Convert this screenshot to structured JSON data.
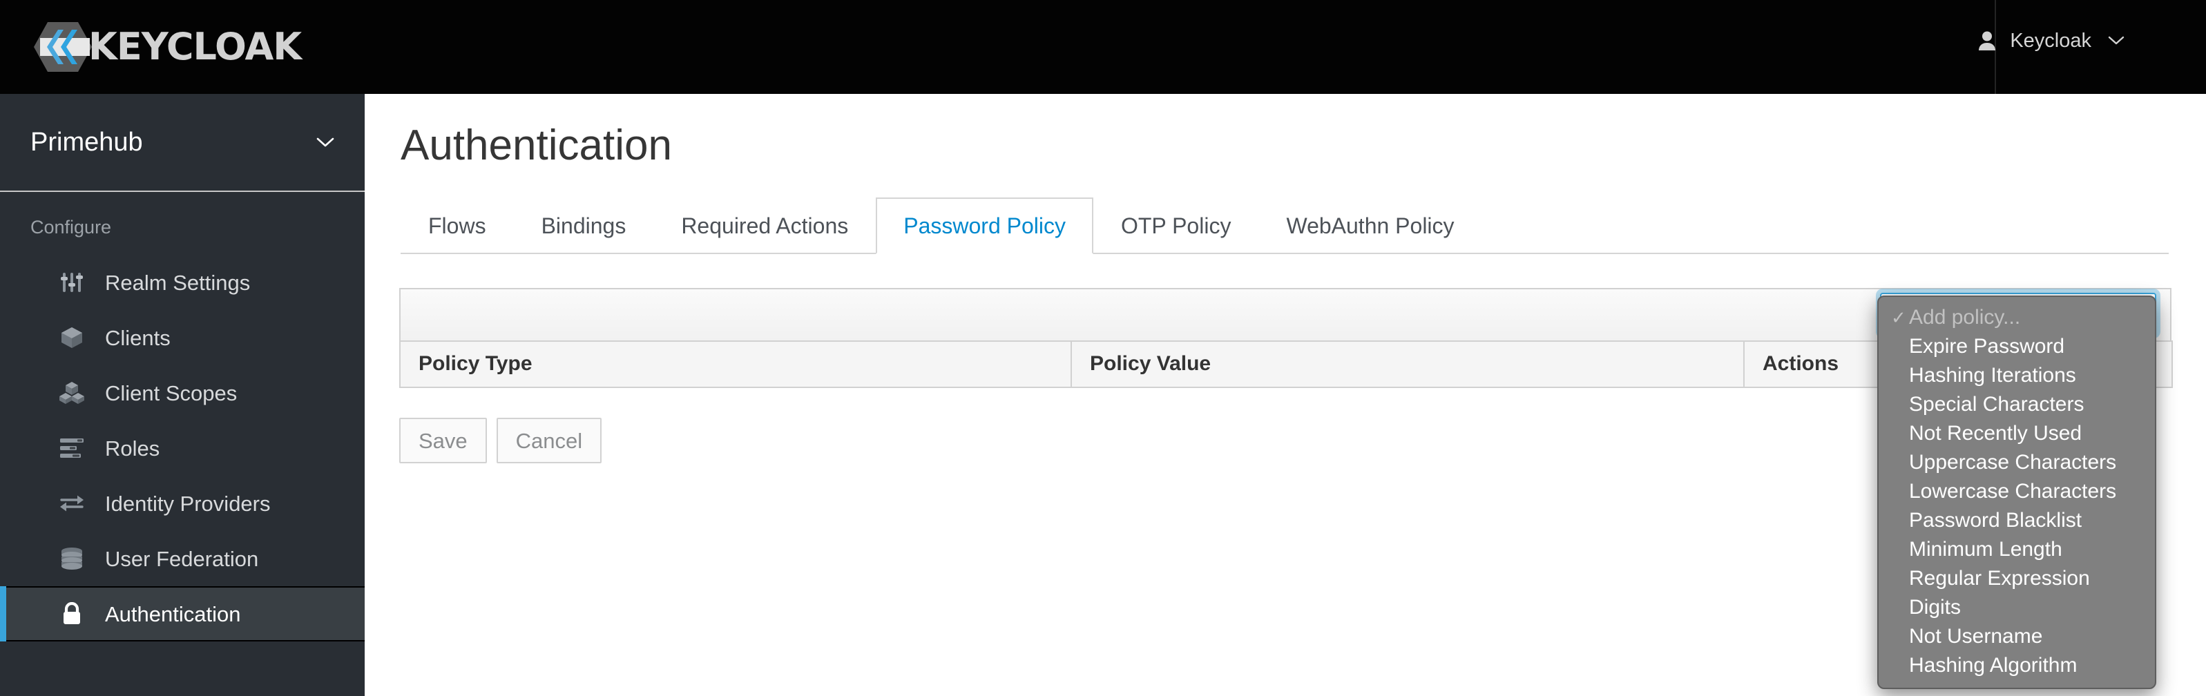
{
  "masthead": {
    "brand_name": "KEYCLOAK",
    "brand_icon": "keycloak-logo-icon",
    "user": {
      "name": "Keycloak",
      "icon": "user-avatar-icon",
      "caret_icon": "chevron-down-icon"
    }
  },
  "sidebar": {
    "realm": {
      "name": "Primehub",
      "caret_icon": "chevron-down-icon"
    },
    "section_title": "Configure",
    "items": [
      {
        "label": "Realm Settings",
        "icon": "sliders-icon",
        "active": false
      },
      {
        "label": "Clients",
        "icon": "cube-icon",
        "active": false
      },
      {
        "label": "Client Scopes",
        "icon": "cubes-icon",
        "active": false
      },
      {
        "label": "Roles",
        "icon": "list-bars-icon",
        "active": false
      },
      {
        "label": "Identity Providers",
        "icon": "exchange-arrows-icon",
        "active": false
      },
      {
        "label": "User Federation",
        "icon": "database-icon",
        "active": false
      },
      {
        "label": "Authentication",
        "icon": "lock-icon",
        "active": true
      }
    ]
  },
  "main": {
    "page_title": "Authentication",
    "tabs": [
      {
        "label": "Flows",
        "active": false
      },
      {
        "label": "Bindings",
        "active": false
      },
      {
        "label": "Required Actions",
        "active": false
      },
      {
        "label": "Password Policy",
        "active": true
      },
      {
        "label": "OTP Policy",
        "active": false
      },
      {
        "label": "WebAuthn Policy",
        "active": false
      }
    ],
    "table": {
      "columns": [
        "Policy Type",
        "Policy Value",
        "Actions"
      ],
      "rows": []
    },
    "buttons": {
      "save": "Save",
      "cancel": "Cancel"
    },
    "policy_select": {
      "selected": "Add policy...",
      "check_glyph": "✓",
      "options": [
        "Add policy...",
        "Expire Password",
        "Hashing Iterations",
        "Special Characters",
        "Not Recently Used",
        "Uppercase Characters",
        "Lowercase Characters",
        "Password Blacklist",
        "Minimum Length",
        "Regular Expression",
        "Digits",
        "Not Username",
        "Hashing Algorithm"
      ]
    }
  },
  "colors": {
    "masthead_bg": "#030303",
    "sidebar_bg": "#292e34",
    "sidebar_active_bg": "#393f44",
    "accent_blue": "#39a5dc",
    "tab_active_text": "#0088ce",
    "dropdown_bg": "#808080"
  }
}
